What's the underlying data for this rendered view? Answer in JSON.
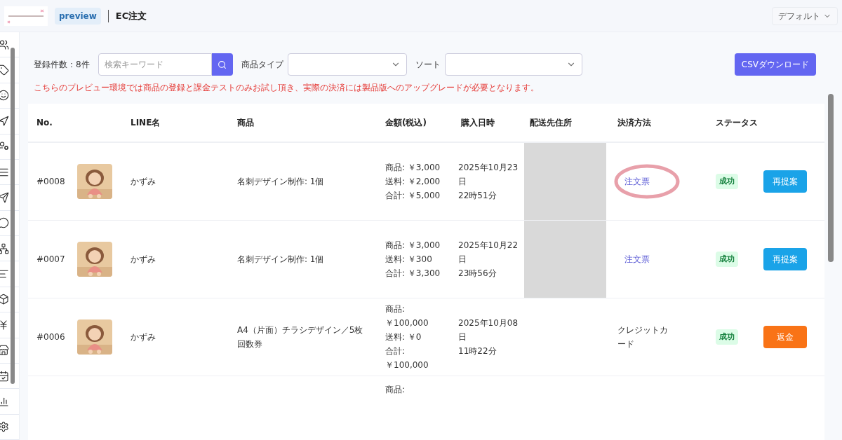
{
  "header": {
    "badge": "preview",
    "title": "EC注文",
    "view_select": "デフォルト"
  },
  "sidebar": {
    "icons": [
      {
        "kind": "users"
      },
      {
        "kind": "tag"
      },
      {
        "kind": "smile"
      },
      {
        "kind": "direction"
      },
      {
        "kind": "user-cog"
      },
      {
        "kind": "menu"
      },
      {
        "kind": "send"
      },
      {
        "kind": "line"
      },
      {
        "kind": "network"
      },
      {
        "kind": "text"
      },
      {
        "kind": "box"
      },
      {
        "kind": "yen"
      },
      {
        "kind": "store"
      },
      {
        "kind": "calendar"
      },
      {
        "kind": "chart"
      },
      {
        "kind": "settings"
      }
    ]
  },
  "toolbar": {
    "count": "登録件数：8件",
    "search": {
      "placeholder": "検索キーワード"
    },
    "type_label": "商品タイプ",
    "sort_label": "ソート",
    "csv_button": "CSVダウンロード"
  },
  "notice": "こちらのプレビュー環境では商品の登録と課金テストのみお試し頂き、実際の決済には製品版へのアップグレードが必要となります。",
  "table": {
    "columns": [
      "No.",
      "LINE名",
      "商品",
      "金額(税込)",
      "購入日時",
      "配送先住所",
      "決済方法",
      "ステータス"
    ],
    "rows": [
      {
        "no": "#0008",
        "name": "かずみ",
        "product": "名刺デザイン制作: 1個",
        "amount": [
          "商品: ￥3,000",
          "送料: ￥2,000",
          "合計: ￥5,000"
        ],
        "date": [
          "2025年10月23",
          "日",
          "22時51分"
        ],
        "address_hidden": true,
        "payment": {
          "kind": "link",
          "label": "注文票"
        },
        "circled": true,
        "status": "成功",
        "action": {
          "kind": "repropose",
          "label": "再提案"
        }
      },
      {
        "no": "#0007",
        "name": "かずみ",
        "product": "名刺デザイン制作: 1個",
        "amount": [
          "商品: ￥3,000",
          "送料: ￥300",
          "合計: ￥3,300"
        ],
        "date": [
          "2025年10月22",
          "日",
          "23時56分"
        ],
        "address_hidden": true,
        "payment": {
          "kind": "link",
          "label": "注文票"
        },
        "circled": false,
        "status": "成功",
        "action": {
          "kind": "repropose",
          "label": "再提案"
        }
      },
      {
        "no": "#0006",
        "name": "かずみ",
        "product": "A4（片面）チラシデザイン／5枚回数券",
        "amount": [
          "商品:",
          "￥100,000",
          "送料: ￥0",
          "合計:",
          "￥100,000"
        ],
        "date": [
          "2025年10月08",
          "日",
          "11時22分"
        ],
        "address_hidden": false,
        "payment": {
          "kind": "text",
          "label": "クレジットカード"
        },
        "circled": false,
        "status": "成功",
        "action": {
          "kind": "refund",
          "label": "返金"
        }
      }
    ],
    "partial_row": {
      "amount": "商品:"
    }
  }
}
